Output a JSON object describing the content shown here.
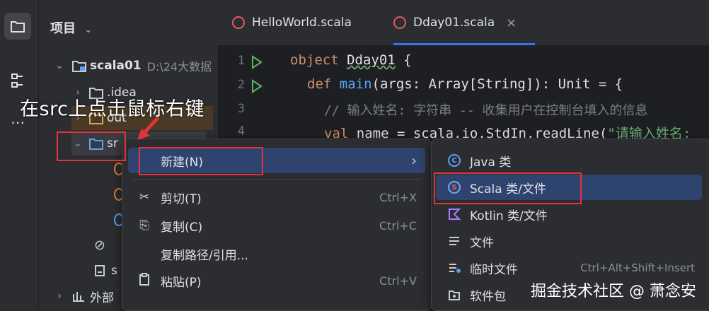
{
  "project_panel": {
    "title": "项目",
    "items": [
      {
        "label": "scala01",
        "path": "D:\\24大数据"
      },
      {
        "label": ".idea"
      },
      {
        "label": "out"
      },
      {
        "label": "sr"
      },
      {
        "label": "s"
      },
      {
        "label": "外部"
      }
    ]
  },
  "editor": {
    "tabs": [
      {
        "label": "HelloWorld.scala"
      },
      {
        "label": "Dday01.scala",
        "close": "×"
      }
    ],
    "line_numbers": [
      "1",
      "2",
      "3",
      "4"
    ],
    "code": {
      "l1_kw": "object ",
      "l1_name": "Dday01",
      "l1_rest": " {",
      "l2_kw": "def ",
      "l2_fn": "main",
      "l2_rest": "(args: Array[String]): Unit = {",
      "l3_comment": "// 输入姓名: 字符串 -- 收集用户在控制台填入的信息",
      "l4_kw": "val ",
      "l4_rest": "name = scala.io.StdIn.readLine(",
      "l4_str": "\"请输入姓名:"
    }
  },
  "context_menu": {
    "items": [
      {
        "icon": "",
        "label": "新建(N)",
        "shortcut": "",
        "arrow": "›"
      },
      {
        "icon": "✂",
        "label": "剪切(T)",
        "shortcut": "Ctrl+X"
      },
      {
        "icon": "⎘",
        "label": "复制(C)",
        "shortcut": "Ctrl+C"
      },
      {
        "icon": "",
        "label": "复制路径/引用...",
        "shortcut": ""
      },
      {
        "icon": "📋",
        "label": "粘贴(P)",
        "shortcut": "Ctrl+V"
      }
    ]
  },
  "submenu": {
    "items": [
      {
        "label": "Java 类"
      },
      {
        "label": "Scala 类/文件"
      },
      {
        "label": "Kotlin 类/文件"
      },
      {
        "label": "文件"
      },
      {
        "label": "临时文件",
        "shortcut": "Ctrl+Alt+Shift+Insert"
      },
      {
        "label": "软件包"
      }
    ]
  },
  "annotation": "在src上点击鼠标右键",
  "watermark": "掘金技术社区 @ 萧念安",
  "colors": {
    "highlight": "#2e436e",
    "annotation_red": "#e5333a",
    "scala_icon": "#e05b5b"
  }
}
